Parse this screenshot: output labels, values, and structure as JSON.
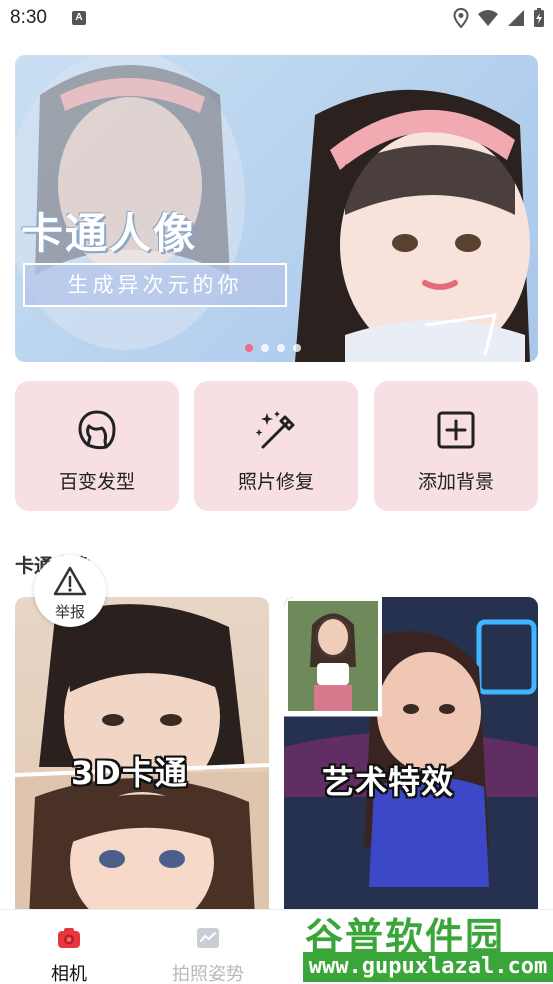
{
  "status_bar": {
    "time": "8:30",
    "notification_icon": "A",
    "icons": [
      "location-icon",
      "wifi-icon",
      "signal-icon",
      "battery-charging-icon"
    ]
  },
  "banner": {
    "title": "卡通人像",
    "subtitle": "生成异次元的你",
    "dot_count": 4,
    "active_dot": 0
  },
  "features": [
    {
      "label": "百变发型",
      "icon": "hair-icon"
    },
    {
      "label": "照片修复",
      "icon": "magic-wand-icon"
    },
    {
      "label": "添加背景",
      "icon": "add-square-icon"
    }
  ],
  "section": {
    "title": "卡通人像",
    "report_label": "举报"
  },
  "cards": [
    {
      "label": "3D卡通"
    },
    {
      "label": "艺术特效"
    }
  ],
  "bottom_nav": [
    {
      "label": "相机",
      "icon": "camera-icon",
      "active": true
    },
    {
      "label": "拍照姿势",
      "icon": "pose-icon",
      "active": false
    }
  ],
  "watermark": {
    "title": "谷普软件园",
    "url": "www.gupuxlazal.com"
  },
  "colors": {
    "accent": "#e8363e",
    "feature_bg": "#f7dfe4",
    "watermark_green": "#3aa63a"
  }
}
